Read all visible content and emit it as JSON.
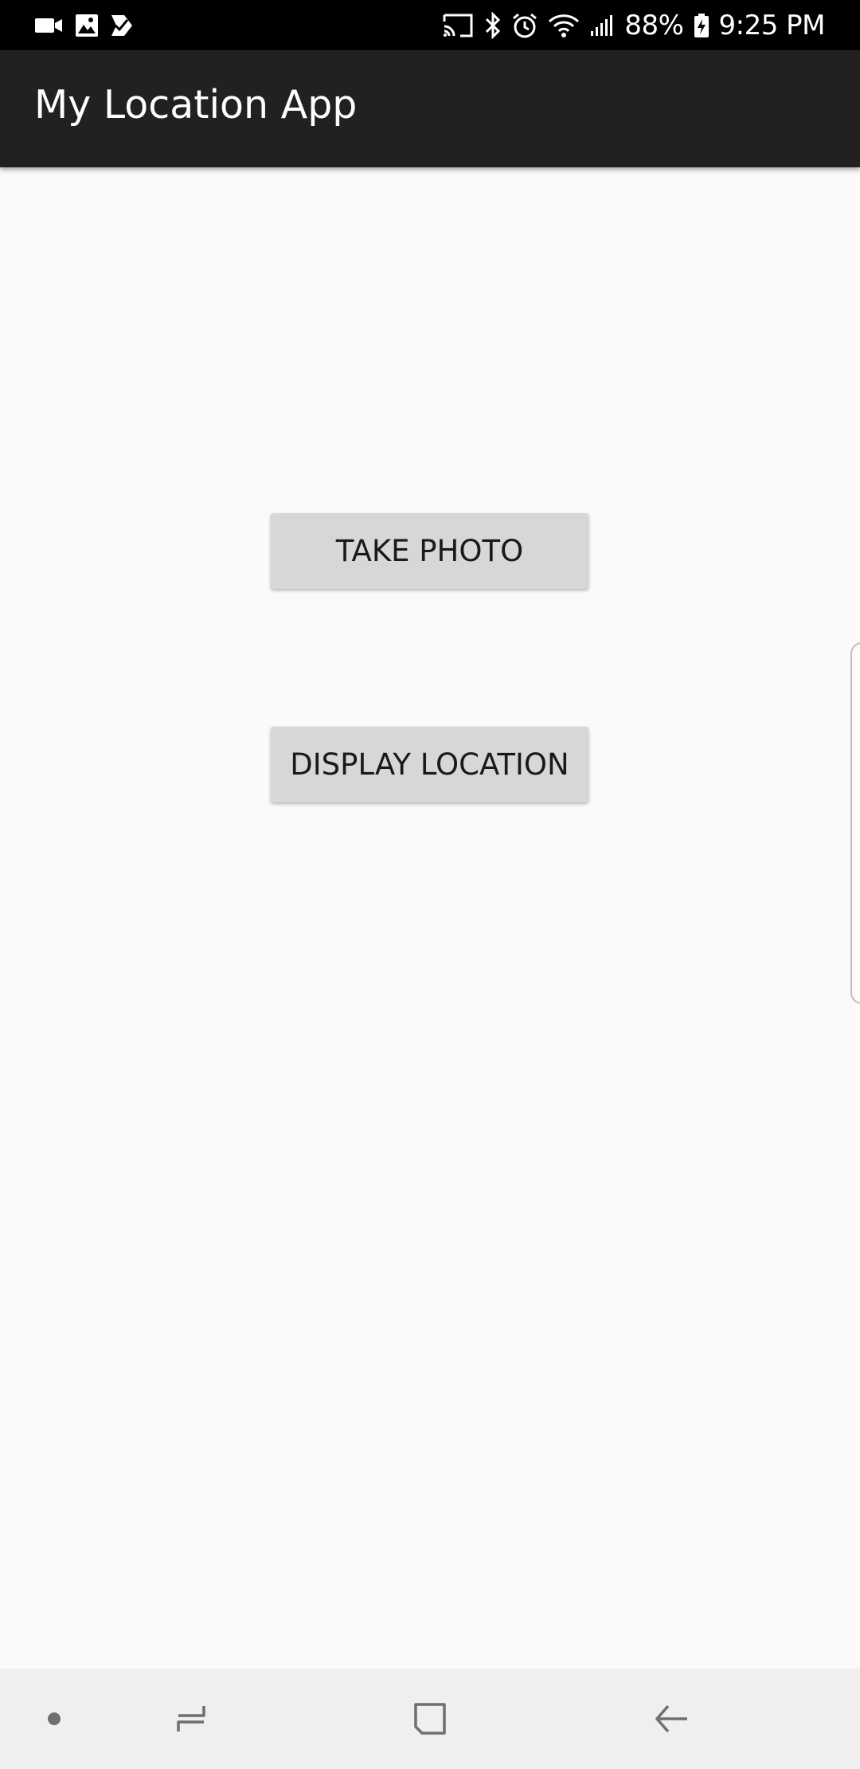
{
  "status_bar": {
    "left_icons": [
      "video-camera-icon",
      "image-icon",
      "check-clipboard-icon"
    ],
    "right_icons": [
      "cast-icon",
      "bluetooth-icon",
      "alarm-icon",
      "wifi-icon",
      "cellular-signal-icon",
      "battery-charging-icon"
    ],
    "battery_percent": "88%",
    "time": "9:25 PM",
    "background": "#000000"
  },
  "app_bar": {
    "title": "My Location App",
    "background": "#212121"
  },
  "main": {
    "background": "#fafafa",
    "take_photo_label": "TAKE PHOTO",
    "display_location_label": "DISPLAY LOCATION",
    "button_color": "#d6d7d7"
  },
  "nav_bar": {
    "background": "#efefef",
    "icons": [
      "dot-icon",
      "recent-apps-icon",
      "home-icon",
      "back-arrow-icon"
    ]
  }
}
